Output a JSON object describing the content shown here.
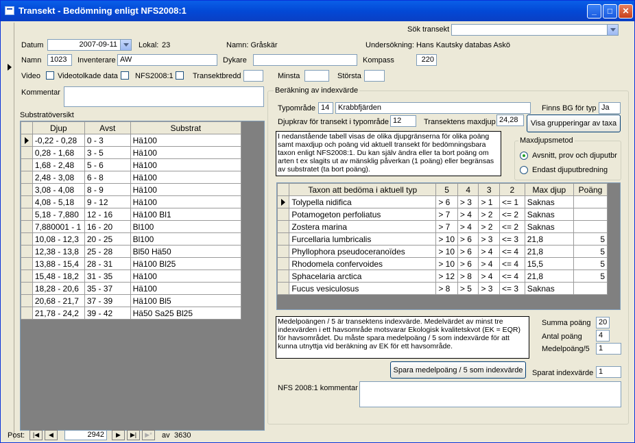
{
  "window": {
    "title": "Transekt - Bedömning enligt NFS2008:1",
    "controls": [
      "_",
      "□",
      "✕"
    ]
  },
  "search": {
    "label": "Sök transekt",
    "value": ""
  },
  "header": {
    "datum_label": "Datum",
    "datum_value": "2007-09-11",
    "lokal_label": "Lokal:",
    "lokal_value": "23",
    "namn_text": "Namn: Gråskär",
    "undersokning_text": "Undersökning: Hans Kautsky databas Askö",
    "namn_label": "Namn",
    "namn_value": "1023",
    "inventerare_label": "Inventerare",
    "inventerare_value": "AW",
    "dykare_label": "Dykare",
    "dykare_value": "",
    "kompass_label": "Kompass",
    "kompass_value": "220",
    "video_label": "Video",
    "videotolkade_label": "Videotolkade data",
    "nfs_label": "NFS2008:1",
    "transektbredd_label": "Transektbredd",
    "minsta_label": "Minsta",
    "storsta_label": "Största",
    "kommentar_label": "Kommentar"
  },
  "substrat": {
    "title": "Substratöversikt",
    "columns": [
      "Djup",
      "Avst",
      "Substrat"
    ],
    "rows": [
      [
        "-0,22 - 0,28",
        "0 - 3",
        "Hä100"
      ],
      [
        "0,28 - 1,68",
        "3 - 5",
        "Hä100"
      ],
      [
        "1,68 - 2,48",
        "5 - 6",
        "Hä100"
      ],
      [
        "2,48 - 3,08",
        "6 - 8",
        "Hä100"
      ],
      [
        "3,08 - 4,08",
        "8 - 9",
        "Hä100"
      ],
      [
        "4,08 - 5,18",
        "9 - 12",
        "Hä100"
      ],
      [
        "5,18 - 7,880",
        "12 - 16",
        "Hä100 Bl1"
      ],
      [
        "7,880001 - 1",
        "16 - 20",
        "Bl100"
      ],
      [
        "10,08 - 12,3",
        "20 - 25",
        "Bl100"
      ],
      [
        "12,38 - 13,8",
        "25 - 28",
        "Bl50 Hä50"
      ],
      [
        "13,88 - 15,4",
        "28 - 31",
        "Hä100 Bl25"
      ],
      [
        "15,48 - 18,2",
        "31 - 35",
        "Hä100"
      ],
      [
        "18,28 - 20,6",
        "35 - 37",
        "Hä100"
      ],
      [
        "20,68 - 21,7",
        "37 - 39",
        "Hä100 Bl5"
      ],
      [
        "21,78 - 24,2",
        "39 - 42",
        "Hä50 Sa25 Bl25"
      ]
    ]
  },
  "index": {
    "group_title": "Beräkning av indexvärde",
    "typomrade_label": "Typområde",
    "typomrade_num": "14",
    "typomrade_name": "Krabbfjärden",
    "finns_bg_label": "Finns BG för typ",
    "finns_bg_value": "Ja",
    "djupkrav_label": "Djupkrav för transekt i typområde",
    "djupkrav_value": "12",
    "maxdjup_label": "Transektens maxdjup",
    "maxdjup_value": "24,28",
    "visa_button": "Visa grupperingar av taxa",
    "info_text": "I nedanstående tabell visas de olika djupgränserna för olika poäng samt maxdjup och poäng vid aktuell transekt för bedömningsbara taxon enligt NFS2008:1. Du kan själv ändra eller ta bort poäng om arten t ex slagits ut av mänsklig påverkan (1 poäng) eller begränsas av substratet (ta bort poäng).",
    "maxdjupsmetod_title": "Maxdjupsmetod",
    "radio1": "Avsnitt, prov och djuputbr",
    "radio2": "Endast djuputbredning",
    "taxa_columns": [
      "Taxon att bedöma i aktuell typ",
      "5",
      "4",
      "3",
      "2",
      "Max djup",
      "Poäng"
    ],
    "taxa_rows": [
      [
        "Tolypella nidifica",
        "> 6",
        "> 3",
        "> 1",
        "<= 1",
        "Saknas",
        ""
      ],
      [
        "Potamogeton perfoliatus",
        "> 7",
        "> 4",
        "> 2",
        "<= 2",
        "Saknas",
        ""
      ],
      [
        "Zostera marina",
        "> 7",
        "> 4",
        "> 2",
        "<= 2",
        "Saknas",
        ""
      ],
      [
        "Furcellaria lumbricalis",
        "> 10",
        "> 6",
        "> 3",
        "<= 3",
        "21,8",
        "5"
      ],
      [
        "Phyllophora pseudoceranoïdes",
        "> 10",
        "> 6",
        "> 4",
        "<= 4",
        "21,8",
        "5"
      ],
      [
        "Rhodomela confervoides",
        "> 10",
        "> 6",
        "> 4",
        "<= 4",
        "15,5",
        "5"
      ],
      [
        "Sphacelaria arctica",
        "> 12",
        "> 8",
        "> 4",
        "<= 4",
        "21,8",
        "5"
      ],
      [
        "Fucus vesiculosus",
        "> 8",
        "> 5",
        "> 3",
        "<= 3",
        "Saknas",
        ""
      ]
    ],
    "medel_text": "Medelpoängen / 5 är transektens indexvärde. Medelvärdet av minst tre indexvärden i ett havsområde motsvarar Ekologisk kvalitetskvot (EK = EQR) för havsområdet. Du måste spara medelpoäng / 5 som indexvärde för att kunna utnyttja vid beräkning av EK för ett havsområde.",
    "summa_label": "Summa poäng",
    "summa_value": "20",
    "antal_label": "Antal poäng",
    "antal_value": "4",
    "medelpoang_label": "Medelpoäng/5",
    "medelpoang_value": "1",
    "spara_button": "Spara medelpoäng / 5 som indexvärde",
    "sparat_label": "Sparat indexvärde",
    "sparat_value": "1",
    "nfs_kommentar_label": "NFS 2008:1 kommentar"
  },
  "nav": {
    "label": "Post:",
    "current": "2942",
    "of": "av",
    "total": "3630"
  }
}
